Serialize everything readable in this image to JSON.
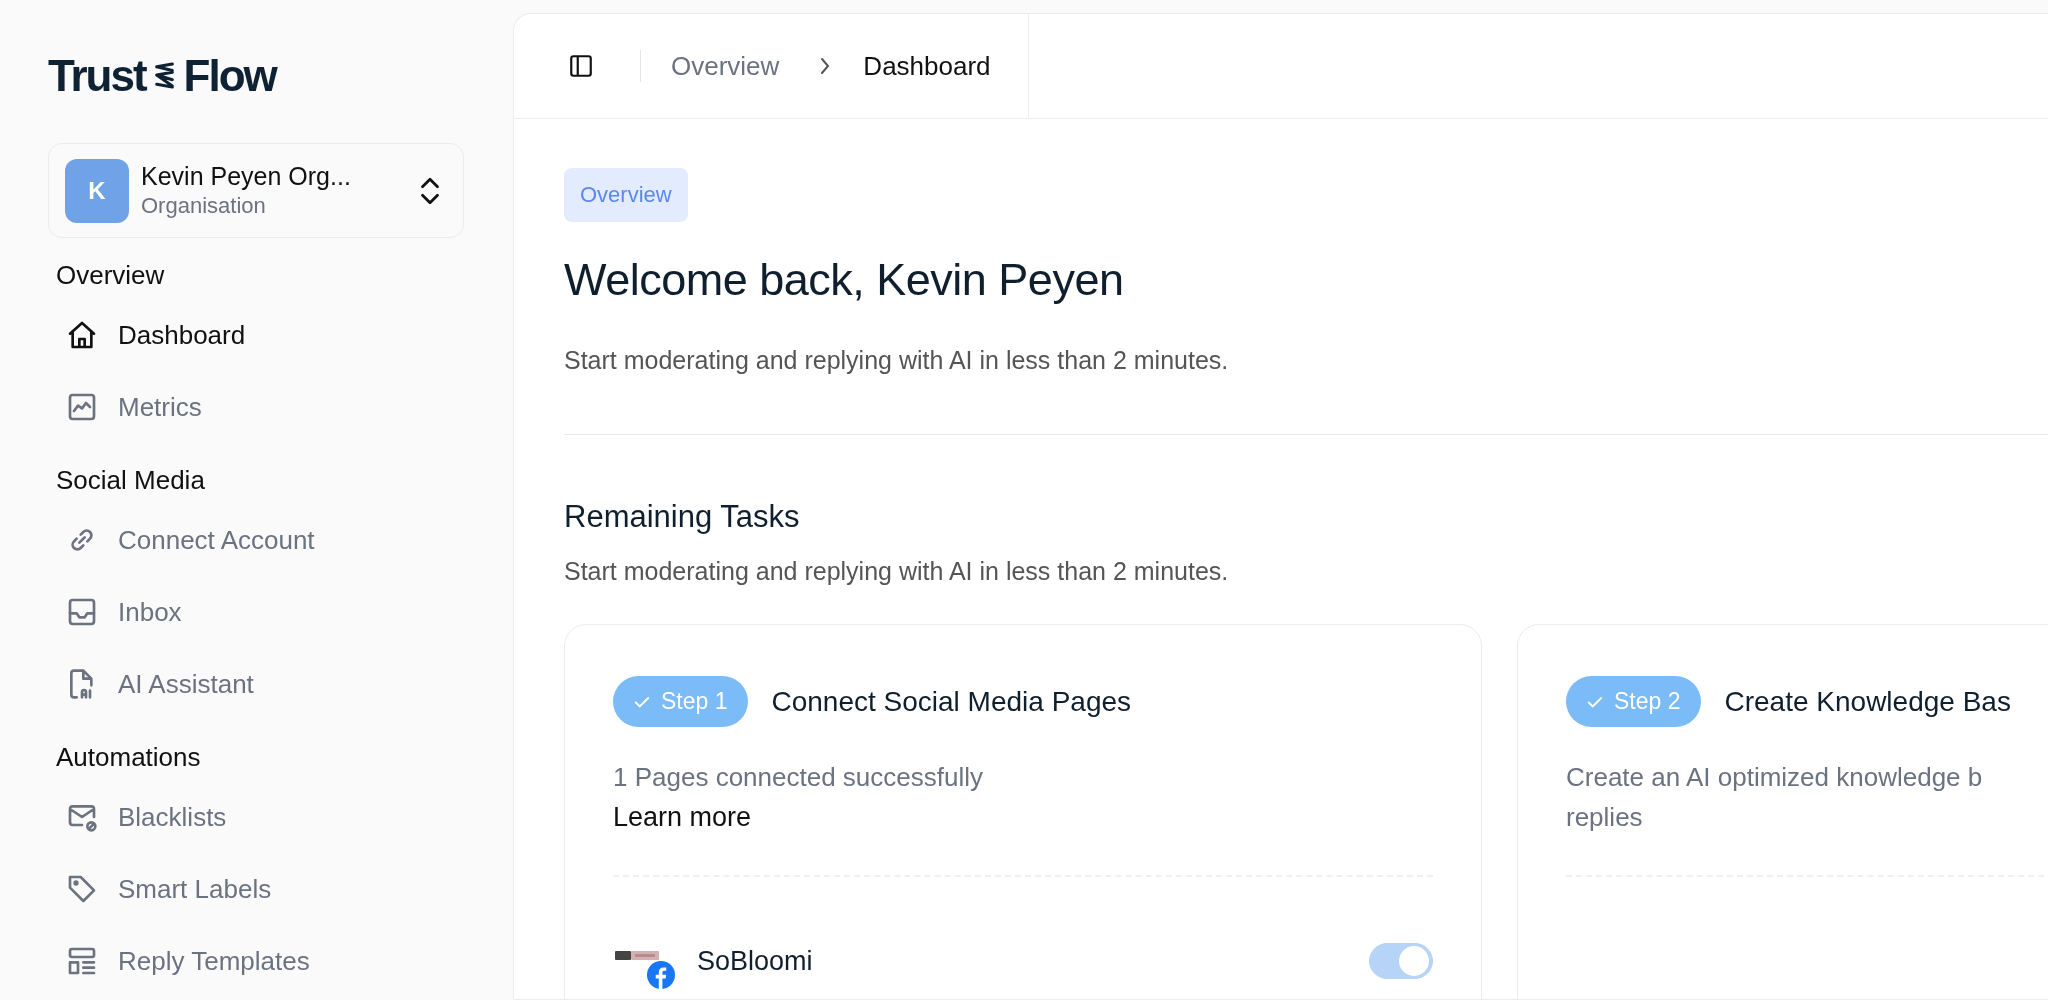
{
  "logo": {
    "left": "Trust",
    "right": "Flow"
  },
  "org_switcher": {
    "initial": "K",
    "name": "Kevin Peyen Org...",
    "subtitle": "Organisation"
  },
  "sidebar": {
    "sections": [
      {
        "title": "Overview",
        "items": [
          {
            "label": "Dashboard",
            "selected": true
          },
          {
            "label": "Metrics",
            "selected": false
          }
        ]
      },
      {
        "title": "Social Media",
        "items": [
          {
            "label": "Connect Account",
            "selected": false
          },
          {
            "label": "Inbox",
            "selected": false
          },
          {
            "label": "AI Assistant",
            "selected": false
          }
        ]
      },
      {
        "title": "Automations",
        "items": [
          {
            "label": "Blacklists",
            "selected": false
          },
          {
            "label": "Smart Labels",
            "selected": false
          },
          {
            "label": "Reply Templates",
            "selected": false
          }
        ]
      }
    ]
  },
  "breadcrumb": [
    "Overview",
    "Dashboard"
  ],
  "page": {
    "badge": "Overview",
    "title": "Welcome back, Kevin Peyen",
    "subtitle": "Start moderating and replying with AI in less than 2 minutes."
  },
  "tasks": {
    "title": "Remaining Tasks",
    "subtitle": "Start moderating and replying with AI in less than 2 minutes.",
    "cards": [
      {
        "step": "Step 1",
        "done": true,
        "title": "Connect Social Media Pages",
        "lines": [
          "1 Pages connected successfully"
        ],
        "link": "Learn more",
        "pages": [
          {
            "name": "SoBloomi",
            "on": true
          }
        ]
      },
      {
        "step": "Step 2",
        "done": true,
        "title": "Create Knowledge Bas",
        "lines": [
          "Create an AI optimized knowledge b",
          "replies"
        ]
      }
    ]
  }
}
